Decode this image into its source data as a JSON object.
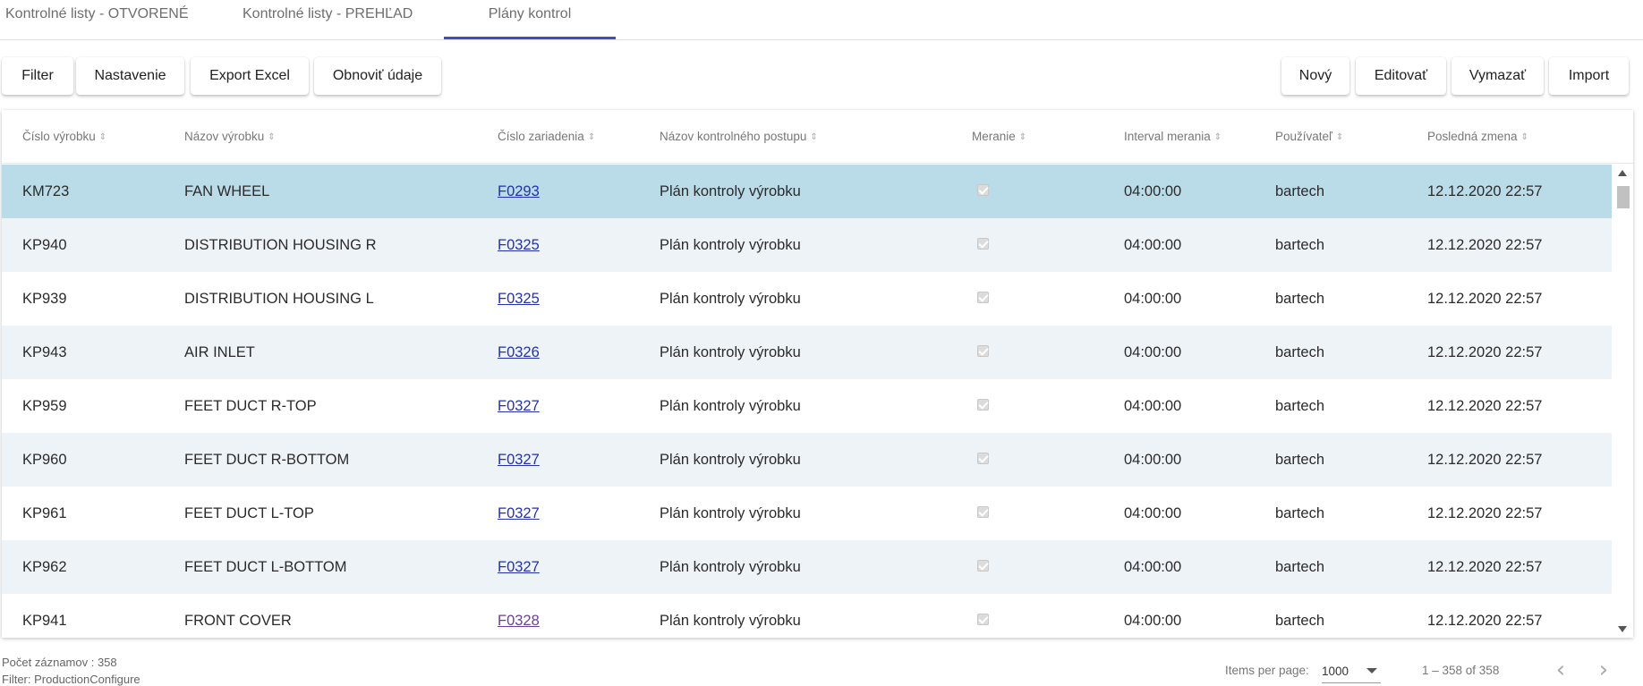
{
  "tabs": [
    {
      "label": "Kontrolné listy - OTVORENÉ"
    },
    {
      "label": "Kontrolné listy - PREHĽAD"
    },
    {
      "label": "Plány kontrol"
    }
  ],
  "toolbar": {
    "left": [
      "Filter",
      "Nastavenie",
      "Export Excel",
      "Obnoviť údaje"
    ],
    "right": [
      "Nový",
      "Editovať",
      "Vymazať",
      "Import"
    ]
  },
  "table": {
    "columns": [
      "Číslo výrobku",
      "Názov výrobku",
      "Číslo zariadenia",
      "Názov kontrolného postupu",
      "Meranie",
      "Interval merania",
      "Používateľ",
      "Posledná zmena"
    ],
    "rows": [
      {
        "cislo": "KM723",
        "nazov": "FAN WHEEL",
        "zariadenie": "F0293",
        "postup": "Plán kontroly výrobku",
        "meranie": true,
        "interval": "04:00:00",
        "user": "bartech",
        "zmena": "12.12.2020 22:57",
        "selected": true
      },
      {
        "cislo": "KP940",
        "nazov": "DISTRIBUTION HOUSING R",
        "zariadenie": "F0325",
        "postup": "Plán kontroly výrobku",
        "meranie": true,
        "interval": "04:00:00",
        "user": "bartech",
        "zmena": "12.12.2020 22:57"
      },
      {
        "cislo": "KP939",
        "nazov": "DISTRIBUTION HOUSING L",
        "zariadenie": "F0325",
        "postup": "Plán kontroly výrobku",
        "meranie": true,
        "interval": "04:00:00",
        "user": "bartech",
        "zmena": "12.12.2020 22:57"
      },
      {
        "cislo": "KP943",
        "nazov": "AIR INLET",
        "zariadenie": "F0326",
        "postup": "Plán kontroly výrobku",
        "meranie": true,
        "interval": "04:00:00",
        "user": "bartech",
        "zmena": "12.12.2020 22:57"
      },
      {
        "cislo": "KP959",
        "nazov": "FEET DUCT R-TOP",
        "zariadenie": "F0327",
        "postup": "Plán kontroly výrobku",
        "meranie": true,
        "interval": "04:00:00",
        "user": "bartech",
        "zmena": "12.12.2020 22:57"
      },
      {
        "cislo": "KP960",
        "nazov": "FEET DUCT R-BOTTOM",
        "zariadenie": "F0327",
        "postup": "Plán kontroly výrobku",
        "meranie": true,
        "interval": "04:00:00",
        "user": "bartech",
        "zmena": "12.12.2020 22:57"
      },
      {
        "cislo": "KP961",
        "nazov": "FEET DUCT L-TOP",
        "zariadenie": "F0327",
        "postup": "Plán kontroly výrobku",
        "meranie": true,
        "interval": "04:00:00",
        "user": "bartech",
        "zmena": "12.12.2020 22:57"
      },
      {
        "cislo": "KP962",
        "nazov": "FEET DUCT L-BOTTOM",
        "zariadenie": "F0327",
        "postup": "Plán kontroly výrobku",
        "meranie": true,
        "interval": "04:00:00",
        "user": "bartech",
        "zmena": "12.12.2020 22:57"
      },
      {
        "cislo": "KP941",
        "nazov": "FRONT COVER",
        "zariadenie": "F0328",
        "postup": "Plán kontroly výrobku",
        "meranie": true,
        "interval": "04:00:00",
        "user": "bartech",
        "zmena": "12.12.2020 22:57",
        "visited": true
      }
    ]
  },
  "footer": {
    "count": "Počet záznamov : 358",
    "filter": "Filter: ProductionConfigure"
  },
  "paginator": {
    "label": "Items per page:",
    "page_size": "1000",
    "range": "1 – 358 of 358",
    "prev_icon": "chevron-left-icon",
    "next_icon": "chevron-right-icon"
  },
  "colors": {
    "accent": "#3f51b5",
    "selected_row": "#b9dce8",
    "stripe_row": "#eef3f8",
    "link": "#2233aa"
  }
}
